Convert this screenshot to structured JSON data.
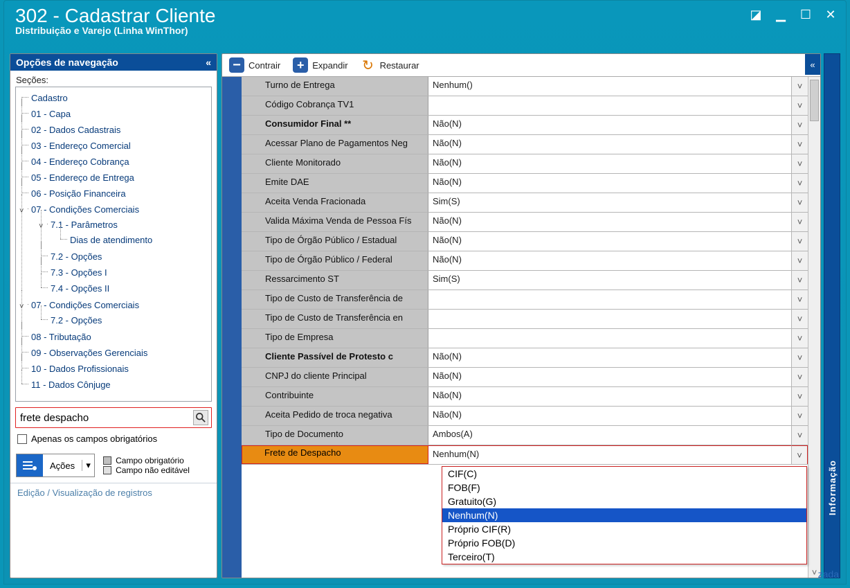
{
  "window": {
    "title": "302 - Cadastrar Cliente",
    "subtitle": "Distribuição e Varejo (Linha WinThor)"
  },
  "nav": {
    "header": "Opções de navegação",
    "sections_label": "Seções:",
    "tree": {
      "root": "Cadastro",
      "items": [
        "01 - Capa",
        "02 - Dados Cadastrais",
        "03 - Endereço Comercial",
        "04 - Endereço Cobrança",
        "05 - Endereço de Entrega",
        "06 - Posição Financeira"
      ],
      "node7a": {
        "label": "07 - Condições Comerciais",
        "c71": "7.1 - Parâmetros",
        "c71a": "Dias de atendimento",
        "c72": "7.2 - Opções",
        "c73": "7.3 - Opções I",
        "c74": "7.4 - Opções II"
      },
      "node7b": {
        "label": "07 - Condições Comerciais",
        "c72": "7.2 - Opções"
      },
      "tail": [
        "08 - Tributação",
        "09 - Observações Gerenciais",
        "10 - Dados Profissionais",
        "11 - Dados Cônjuge"
      ]
    },
    "search_value": "frete despacho",
    "chk_mandatory": "Apenas os campos obrigatórios",
    "actions_label": "Ações",
    "legend_required": "Campo obrigatório",
    "legend_readonly": "Campo não editável",
    "status": "Edição / Visualização de registros"
  },
  "toolbar": {
    "contract": "Contrair",
    "expand": "Expandir",
    "restore": "Restaurar"
  },
  "info_strip": "Informação",
  "footer_link": "zada",
  "grid": {
    "rows": [
      {
        "label": "Turno de Entrega",
        "value": "Nenhum()"
      },
      {
        "label": "Código Cobrança TV1",
        "value": ""
      },
      {
        "label": "Consumidor Final **",
        "value": "Não(N)",
        "bold": true
      },
      {
        "label": "Acessar Plano de Pagamentos Neg",
        "value": "Não(N)"
      },
      {
        "label": "Cliente Monitorado",
        "value": "Não(N)"
      },
      {
        "label": "Emite DAE",
        "value": "Não(N)"
      },
      {
        "label": "Aceita Venda Fracionada",
        "value": "Sim(S)"
      },
      {
        "label": "Valida Máxima Venda de Pessoa Fís",
        "value": "Não(N)"
      },
      {
        "label": "Tipo de Órgão Público / Estadual",
        "value": "Não(N)"
      },
      {
        "label": "Tipo de Órgão Público / Federal",
        "value": "Não(N)"
      },
      {
        "label": "Ressarcimento ST",
        "value": "Sim(S)"
      },
      {
        "label": "Tipo de Custo de Transferência de",
        "value": ""
      },
      {
        "label": "Tipo de Custo de Transferência en",
        "value": ""
      },
      {
        "label": "Tipo de Empresa",
        "value": ""
      },
      {
        "label": "Cliente Passível de Protesto c",
        "value": "Não(N)",
        "bold": true
      },
      {
        "label": "CNPJ do cliente Principal",
        "value": "Não(N)"
      },
      {
        "label": "Contribuinte",
        "value": "Não(N)"
      },
      {
        "label": "Aceita Pedido de troca negativa",
        "value": "Não(N)"
      },
      {
        "label": "Tipo de Documento",
        "value": "Ambos(A)"
      },
      {
        "label": "Frete de Despacho",
        "value": "Nenhum(N)",
        "highlight": true
      }
    ]
  },
  "dropdown": {
    "options": [
      "CIF(C)",
      "FOB(F)",
      "Gratuito(G)",
      "Nenhum(N)",
      "Próprio CIF(R)",
      "Próprio FOB(D)",
      "Terceiro(T)"
    ],
    "selected": "Nenhum(N)"
  }
}
